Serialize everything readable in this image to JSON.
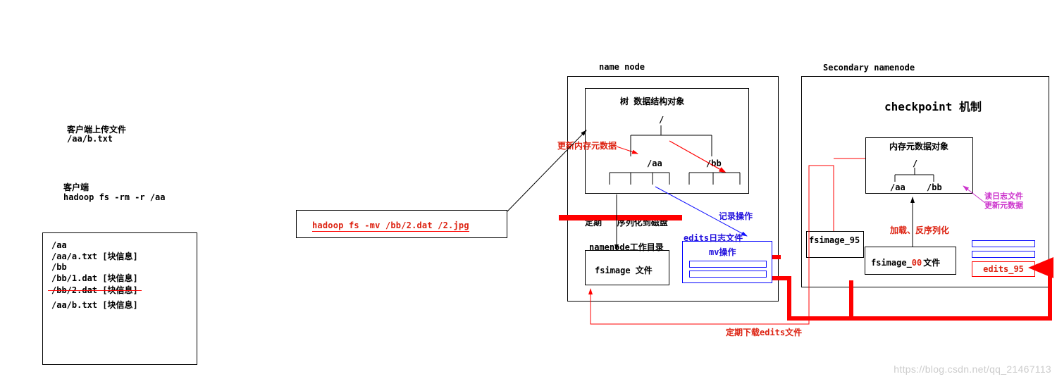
{
  "client": {
    "upload_label": "客户端上传文件",
    "upload_path": "/aa/b.txt",
    "title": "客户端",
    "command": "hadoop fs -rm -r /aa",
    "files": {
      "l1": "/aa",
      "l2": "/aa/a.txt  [块信息]",
      "l3": "/bb",
      "l4": "/bb/1.dat  [块信息]",
      "l5": "/bb/2.dat  [块信息]",
      "l6": "/aa/b.txt  [块信息]"
    },
    "mv_command": "hadoop fs -mv  /bb/2.dat  /2.jpg"
  },
  "namenode": {
    "title": "name node",
    "tree_label": "树 数据结构对象",
    "root": "/",
    "aa": "/aa",
    "bb": "/bb",
    "update_label": "更新内存元数据",
    "periodic_label": "定期",
    "serialize_label": "序列化到磁盘",
    "record_label": "记录操作",
    "edits_title": "edits日志文件",
    "mv_op": "mv操作",
    "workdir_title": "namenode工作目录",
    "fsimage_label": "fsimage  文件"
  },
  "secondary": {
    "title": "Secondary namenode",
    "checkpoint": "checkpoint 机制",
    "mem_title": "内存元数据对象",
    "root": "/",
    "aa": "/aa",
    "bb": "/bb",
    "read_label1": "读日志文件",
    "read_label2": "更新元数据",
    "load_label": "加载、反序列化",
    "fsimage_a": "fsimage_95",
    "fsimage_b_prefix": "fsimage_",
    "fsimage_b_suffix": "00",
    "file_label": "文件",
    "edits_file": "edits_95"
  },
  "download_label": "定期下载edits文件",
  "watermark": "https://blog.csdn.net/qq_21467113"
}
